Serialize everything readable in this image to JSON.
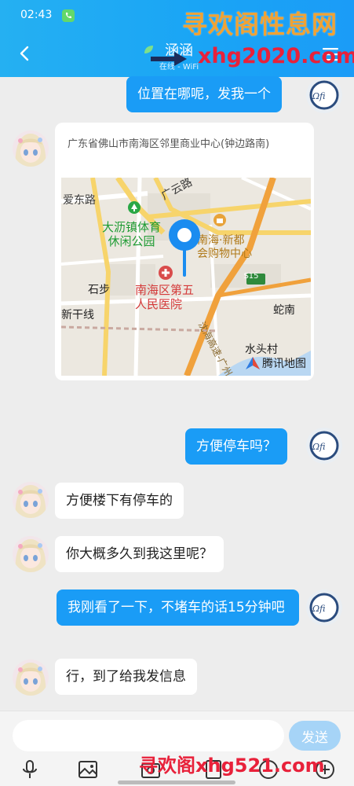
{
  "status": {
    "time": "02:43",
    "right_text": ""
  },
  "header": {
    "title": "涵涵",
    "subtitle": "在线 - WiFi"
  },
  "watermarks": {
    "top_line1": "寻欢阁性息网",
    "top_line2": "xhg2020.com",
    "bottom": "寻欢阁xhg521.com"
  },
  "messages": [
    {
      "from": "me",
      "text": "位置在哪呢，发我一个"
    },
    {
      "from": "other",
      "type": "location",
      "address": "广东省佛山市南海区邻里商业中心(钟边路南)",
      "map_labels": {
        "road_aidong": "爱东路",
        "road_guangyun": "广云路",
        "park_line1": "大沥镇体育",
        "park_line2": "休闲公园",
        "mall_line1": "南海·新都",
        "mall_line2": "会购物中心",
        "shibu": "石步",
        "hospital_line1": "南海区第五",
        "hospital_line2": "人民医院",
        "new_trunk": "新干线",
        "shenan": "蛇南",
        "expressway": "沈海高速-广州",
        "highway_badge": "S15",
        "shuitou": "水头村",
        "provider": "腾讯地图"
      }
    },
    {
      "from": "me",
      "text": "方便停车吗？"
    },
    {
      "from": "other",
      "text": "方便楼下有停车的"
    },
    {
      "from": "other",
      "text": "你大概多久到我这里呢？"
    },
    {
      "from": "me",
      "text": "我刚看了一下，不堵车的话15分钟吧"
    },
    {
      "from": "other",
      "text": "行，到了给我发信息"
    }
  ],
  "input": {
    "placeholder": "",
    "value": "",
    "send_label": "发送"
  },
  "colors": {
    "header": "#1aa5f5",
    "my_bubble": "#1a9cf6",
    "send_button": "#a6d4f7",
    "background": "#ededed"
  }
}
